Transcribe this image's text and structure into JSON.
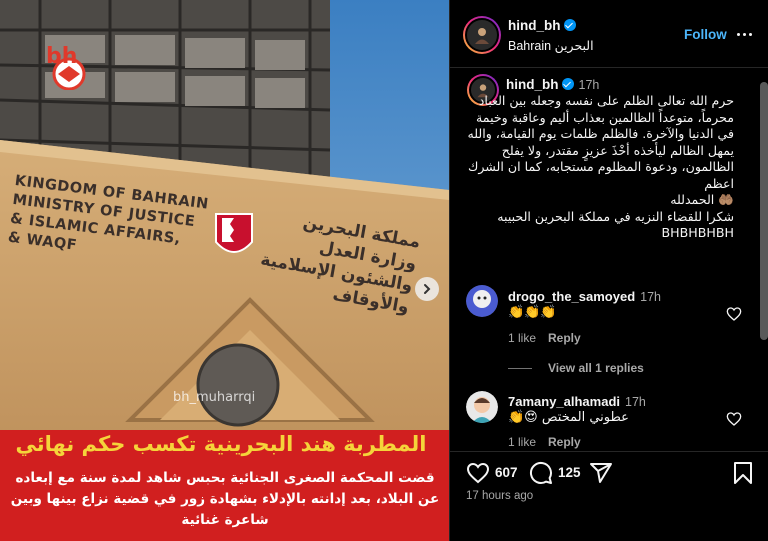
{
  "post": {
    "username": "hind_bh",
    "location": "Bahrain البحرين",
    "follow_label": "Follow",
    "caption_time": "17h",
    "caption": "حرم الله تعالى الظلم على نفسه وجعله بين العباد محرماً، متوعداً الظالمين بعذاب أليم وعاقبة وخيمة في الدنيا والآخرة. فالظلم ظلمات يوم القيامة، والله يمهل الظالم ليأخذه أخْذَ عزيزٍ مقتدر، ولا يفلح الظالمون، ودعوة المظلوم مستجابه، كما ان الشرك اعظم\n🤲🏽 الحمدلله\nشكرا للقضاء النزيه في مملكة البحرين الحبيبه BHBHBHBH",
    "likes": "607",
    "comments": "125",
    "posted_ago": "17 hours ago"
  },
  "media": {
    "logo_text": "bh",
    "watermark": "bh_muharrqi",
    "sign_en": [
      "KINGDOM OF BAHRAIN",
      "MINISTRY OF JUSTICE",
      "& ISLAMIC AFFAIRS,",
      "& WAQF"
    ],
    "sign_ar": [
      "مملكة البحرين",
      "وزارة العدل",
      "والشئون الإسلامية",
      "والأوقاف"
    ],
    "headline": "المطربة هند البحرينية تكسب حكم نهائي",
    "body": "قضت المحكمة الصغرى الجنائية بحبس شاهد لمدة سنة مع إبعاده عن البلاد، بعد إدانته بالإدلاء بشهادة زور في قضية نزاع بينها وبين شاعرة غنائية"
  },
  "comments": [
    {
      "username": "drogo_the_samoyed",
      "time": "17h",
      "text": "👏👏👏",
      "likes": "1 like",
      "reply": "Reply",
      "view_replies": "View all 1 replies"
    },
    {
      "username": "7amany_alhamadi",
      "time": "17h",
      "text": "عطوني المختص 😍👏",
      "likes": "1 like",
      "reply": "Reply"
    }
  ],
  "colors": {
    "accent": "#4cb5f9",
    "verified": "#0095f6",
    "headline_bg": "#d11f1f",
    "headline_text": "#f5d43a"
  },
  "icons": [
    "verified-icon",
    "more-icon",
    "heart-icon",
    "comment-icon",
    "share-icon",
    "save-icon",
    "next-arrow-icon"
  ]
}
